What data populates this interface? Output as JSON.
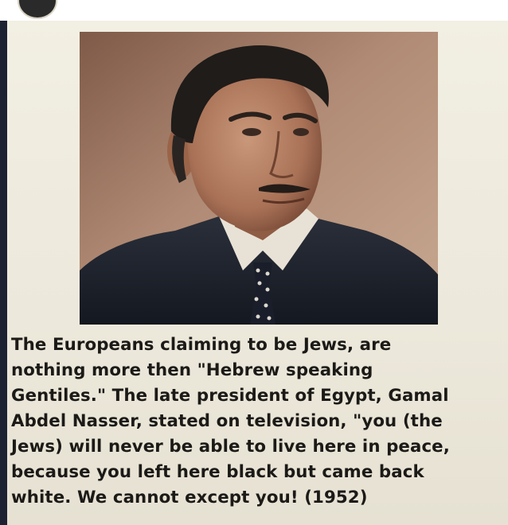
{
  "post": {
    "quote_lines": [
      "The Europeans claiming to be Jews, are",
      "nothing more then \"Hebrew speaking",
      "Gentiles.\" The late president of Egypt, Gamal",
      "Abdel Nasser, stated on television, \"you (the",
      "Jews) will never be able to live here in peace,",
      "because you left here black but came back",
      "white. We cannot except you! (1952)"
    ]
  },
  "colors": {
    "background": "#f4f1e6",
    "text": "#1b1a17",
    "left_bar": "#1d2233"
  }
}
